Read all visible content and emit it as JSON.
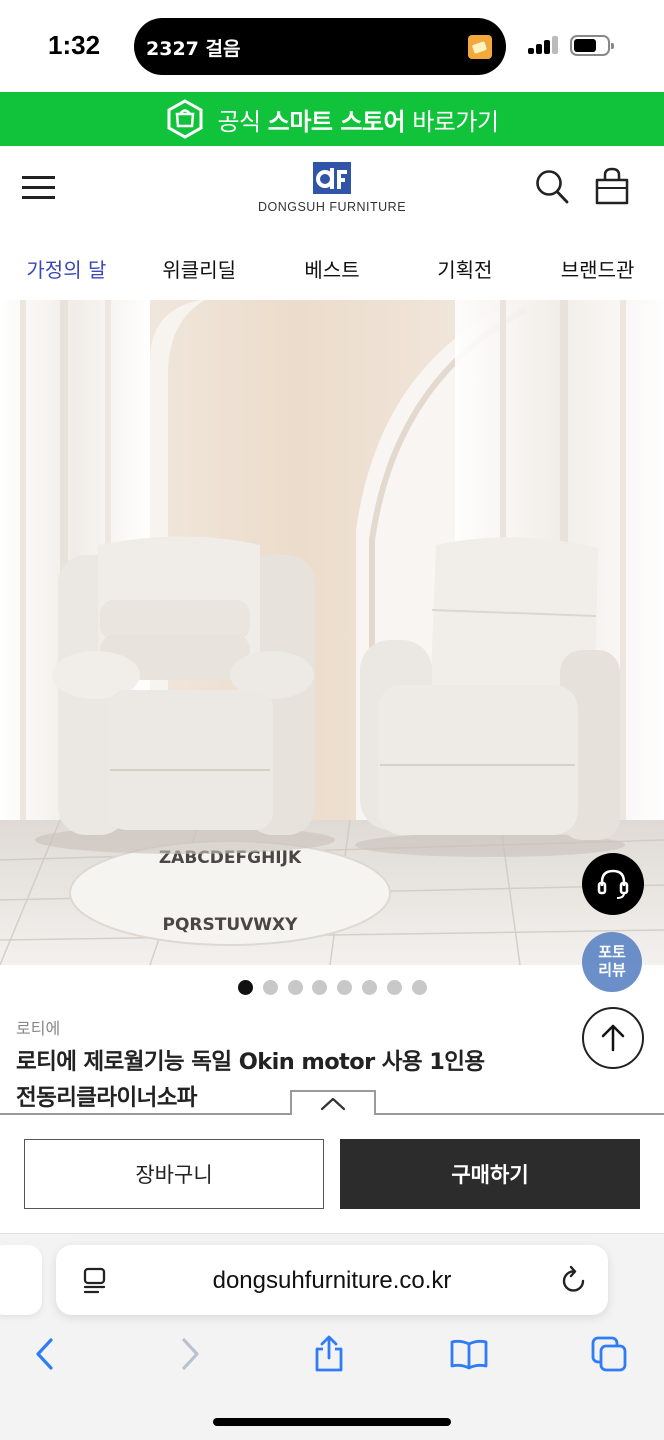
{
  "status_bar": {
    "time": "1:32",
    "activity_text": "2327 걸음",
    "icons": [
      "pedometer-app-icon",
      "signal-icon",
      "battery-icon"
    ]
  },
  "banner": {
    "prefix": "공식 ",
    "highlight": "스마트 스토어",
    "suffix": " 바로가기",
    "background_color": "#10c33a",
    "icon": "smart-store-icon"
  },
  "header": {
    "logo_text": "DONGSUH FURNITURE",
    "logo_color": "#2f54a8",
    "icons": [
      "menu-icon",
      "search-icon",
      "shopping-bag-icon"
    ]
  },
  "nav": {
    "tabs": [
      {
        "label": "가정의 달",
        "active": true
      },
      {
        "label": "위클리딜",
        "active": false
      },
      {
        "label": "베스트",
        "active": false
      },
      {
        "label": "기획전",
        "active": false
      },
      {
        "label": "브랜드관",
        "active": false
      }
    ],
    "active_color": "#3a47b8"
  },
  "hero": {
    "slide_count": 8,
    "active_slide": 1,
    "rug_text": "ZABCDEFGHIJKLMNOPQRSTUVWXY"
  },
  "floating": {
    "cs_icon": "headset-icon",
    "review_line1": "포토",
    "review_line2": "리뷰",
    "top_icon": "arrow-up-icon"
  },
  "product": {
    "brand": "로티에",
    "title_line1": "로티에 제로월기능 독일 Okin motor 사용 1인용",
    "title_line2": "전동리클라이너소파"
  },
  "actions": {
    "cart_label": "장바구니",
    "buy_label": "구매하기"
  },
  "browser": {
    "url": "dongsuhfurniture.co.kr",
    "toolbar_icons": [
      "back-icon",
      "forward-icon",
      "share-icon",
      "bookmarks-icon",
      "tabs-icon"
    ]
  }
}
